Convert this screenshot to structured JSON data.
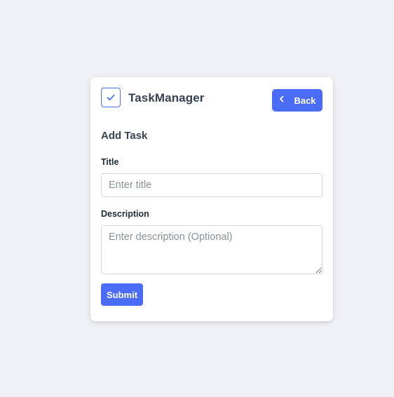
{
  "app": {
    "title": "TaskManager",
    "logo_icon": "check-icon"
  },
  "header": {
    "back_label": "Back",
    "back_icon": "chevron-left-icon"
  },
  "form": {
    "heading": "Add Task",
    "title_label": "Title",
    "title_placeholder": "Enter title",
    "title_value": "",
    "description_label": "Description",
    "description_placeholder": "Enter description (Optional)",
    "description_value": "",
    "submit_label": "Submit"
  },
  "colors": {
    "accent": "#4a6cf7",
    "background": "#f0f1f6",
    "card": "#ffffff",
    "text": "#374151"
  }
}
